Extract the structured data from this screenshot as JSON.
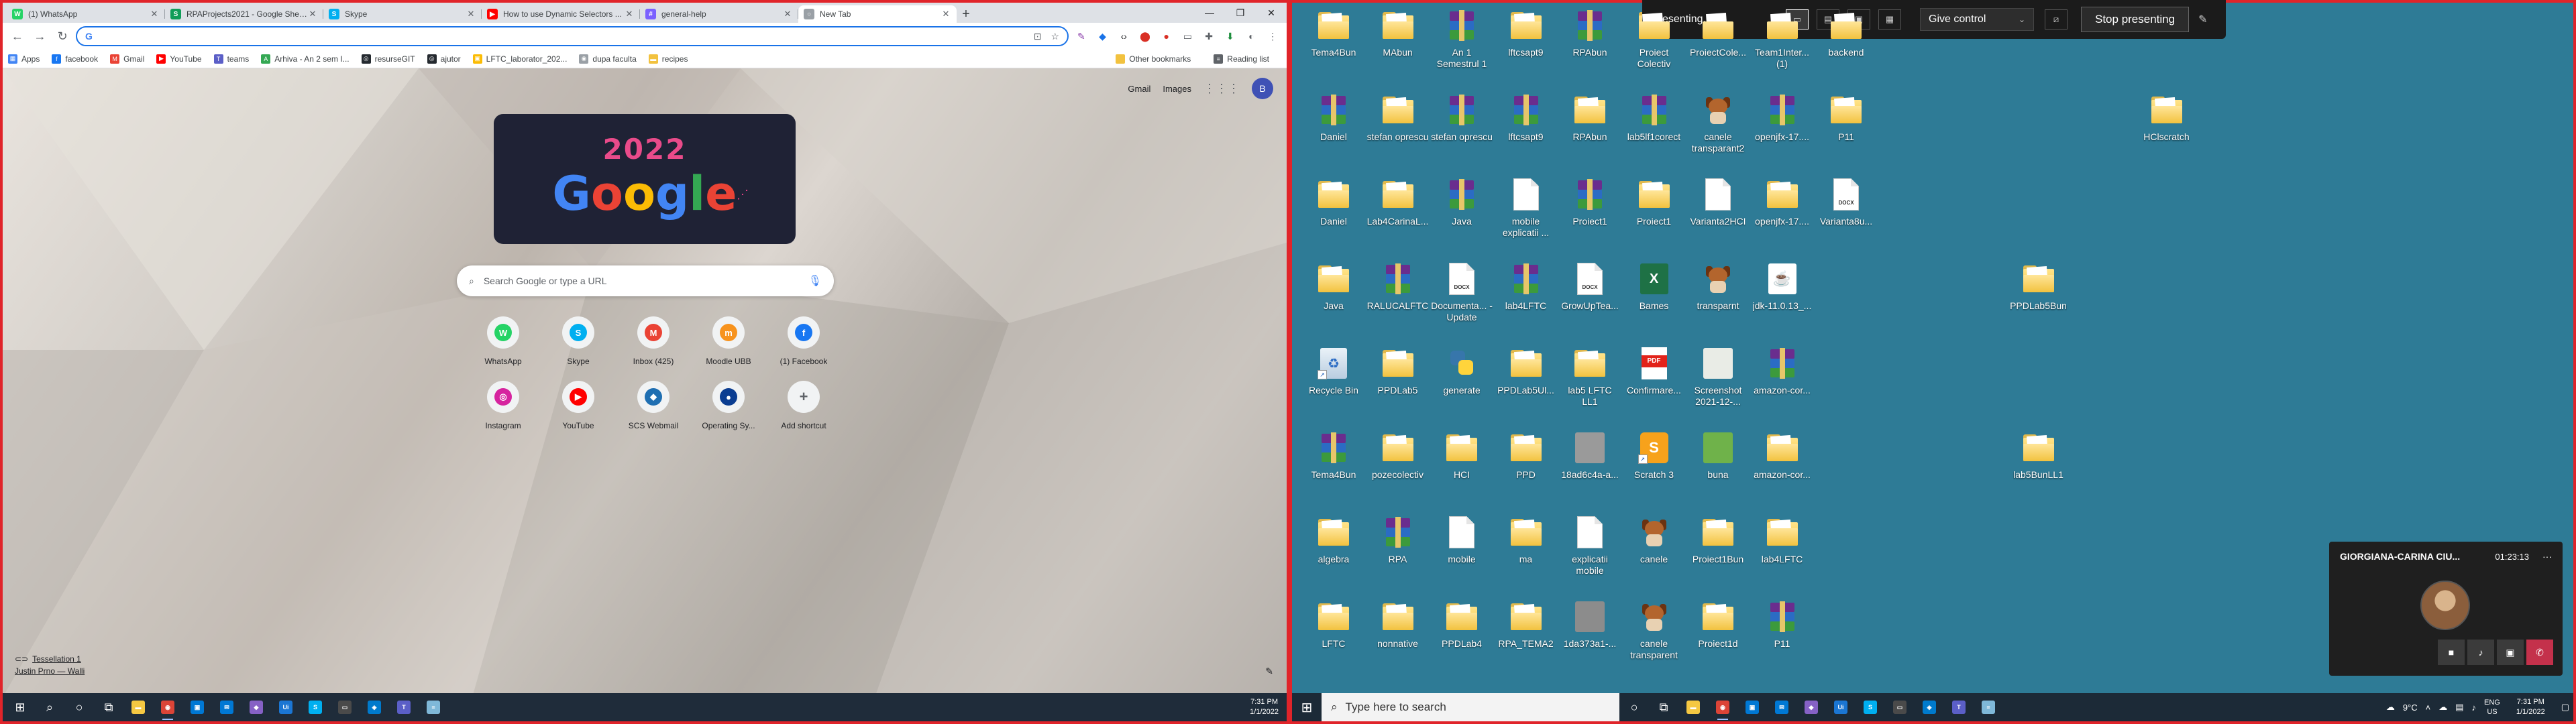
{
  "chrome": {
    "tabs": [
      {
        "label": "(1) WhatsApp",
        "color": "#25d366",
        "glyph": "W"
      },
      {
        "label": "RPAProjects2021 - Google Sheets",
        "color": "#0f9d58",
        "glyph": "S"
      },
      {
        "label": "Skype",
        "color": "#00aff0",
        "glyph": "S"
      },
      {
        "label": "How to use Dynamic Selectors ...",
        "color": "#ff0000",
        "glyph": "▶"
      },
      {
        "label": "general-help",
        "color": "#7b61ff",
        "glyph": "#"
      },
      {
        "label": "New Tab",
        "color": "#9aa0a6",
        "glyph": "○"
      }
    ],
    "window_controls": {
      "minimize": "—",
      "maximize": "❐",
      "close": "✕"
    },
    "nav": {
      "back": "←",
      "forward": "→",
      "reload": "↻"
    },
    "omnibox": {
      "prefix": "G",
      "value": ""
    },
    "bookmarks": [
      {
        "label": "Apps",
        "color": "#4285f4",
        "glyph": "▦"
      },
      {
        "label": "facebook",
        "color": "#1877f2",
        "glyph": "f"
      },
      {
        "label": "Gmail",
        "color": "#ea4335",
        "glyph": "M"
      },
      {
        "label": "YouTube",
        "color": "#ff0000",
        "glyph": "▶"
      },
      {
        "label": "teams",
        "color": "#5b5fc7",
        "glyph": "T"
      },
      {
        "label": "Arhiva - An 2 sem I...",
        "color": "#34a853",
        "glyph": "A"
      },
      {
        "label": "resurseGIT",
        "color": "#24292f",
        "glyph": "◎"
      },
      {
        "label": "ajutor",
        "color": "#24292f",
        "glyph": "◎"
      },
      {
        "label": "LFTC_laborator_202...",
        "color": "#fbbc05",
        "glyph": "▣"
      },
      {
        "label": "dupa faculta",
        "color": "#9aa0a6",
        "glyph": "◉"
      },
      {
        "label": "recipes",
        "color": "#f2c23f",
        "glyph": "▬"
      }
    ],
    "bookmarks_right": {
      "other": "Other bookmarks",
      "reading": "Reading list"
    },
    "ntp": {
      "top_links": {
        "gmail": "Gmail",
        "images": "Images",
        "avatar": "B"
      },
      "doodle": {
        "year": "2022",
        "word": [
          "G",
          "o",
          "o",
          "g",
          "l",
          "e"
        ]
      },
      "search_placeholder": "Search Google or type a URL",
      "shortcuts": [
        {
          "label": "WhatsApp",
          "color": "#25d366",
          "glyph": "W"
        },
        {
          "label": "Skype",
          "color": "#00aff0",
          "glyph": "S"
        },
        {
          "label": "Inbox (425)",
          "color": "#ea4335",
          "glyph": "M"
        },
        {
          "label": "Moodle UBB",
          "color": "#f7931e",
          "glyph": "m"
        },
        {
          "label": "(1) Facebook",
          "color": "#1877f2",
          "glyph": "f"
        },
        {
          "label": "Instagram",
          "color": "#d6249f",
          "glyph": "◎"
        },
        {
          "label": "YouTube",
          "color": "#ff0000",
          "glyph": "▶"
        },
        {
          "label": "SCS Webmail",
          "color": "#1f6fb2",
          "glyph": "◆"
        },
        {
          "label": "Operating Sy...",
          "color": "#0b3d91",
          "glyph": "●"
        },
        {
          "label": "Add shortcut",
          "color": "#5f6368",
          "glyph": "+"
        }
      ],
      "attribution": {
        "title": "Tessellation 1",
        "author": "Justin Prno — Walli"
      },
      "customize_icon": "✎"
    }
  },
  "left_taskbar": {
    "icons": [
      {
        "name": "windows-start-icon",
        "glyph": "⊞",
        "color": "#ffffff"
      },
      {
        "name": "search-icon",
        "glyph": "⌕",
        "color": "#ffffff"
      },
      {
        "name": "cortana-icon",
        "glyph": "○",
        "color": "#ffffff"
      },
      {
        "name": "task-view-icon",
        "glyph": "⧉",
        "color": "#ffffff"
      },
      {
        "name": "file-explorer-icon",
        "glyph": "▬",
        "color": "#f5c842"
      },
      {
        "name": "chrome-icon",
        "glyph": "◉",
        "color": "#db4437"
      },
      {
        "name": "store-icon",
        "glyph": "▣",
        "color": "#0078d4"
      },
      {
        "name": "mail-icon",
        "glyph": "✉",
        "color": "#0078d4"
      },
      {
        "name": "visual-studio-icon",
        "glyph": "◆",
        "color": "#8661c5"
      },
      {
        "name": "uipath-icon",
        "glyph": "Ui",
        "color": "#1b76d3"
      },
      {
        "name": "skype-icon",
        "glyph": "S",
        "color": "#00aff0"
      },
      {
        "name": "terminal-icon",
        "glyph": "▭",
        "color": "#4a4a4a"
      },
      {
        "name": "vscode-icon",
        "glyph": "◈",
        "color": "#007acc"
      },
      {
        "name": "teams-icon",
        "glyph": "T",
        "color": "#5b5fc7"
      },
      {
        "name": "notepad-icon",
        "glyph": "≡",
        "color": "#7fb8d8"
      }
    ],
    "time": "7:31 PM",
    "date": "1/1/2022"
  },
  "presenting": {
    "title": "Presenting...",
    "modes": [
      "▭",
      "▤",
      "▣",
      "▦"
    ],
    "give_control": "Give control",
    "chevron": "⌄",
    "screen_toggle": "⧄",
    "stop": "Stop presenting",
    "pin": "✎"
  },
  "call": {
    "name": "GIORGIANA-CARINA CIU...",
    "time": "01:23:13",
    "more": "···",
    "controls": {
      "video": "■",
      "mic": "♪",
      "share": "▣",
      "end": "✆"
    }
  },
  "desktop_icons": [
    {
      "label": "Tema4Bun",
      "type": "folder",
      "col": 0,
      "row": 0
    },
    {
      "label": "MAbun",
      "type": "folder",
      "col": 1,
      "row": 0
    },
    {
      "label": "An 1 Semestrul 1",
      "type": "rar",
      "col": 2,
      "row": 0
    },
    {
      "label": "lftcsapt9",
      "type": "folder",
      "col": 3,
      "row": 0
    },
    {
      "label": "RPAbun",
      "type": "rar",
      "col": 4,
      "row": 0
    },
    {
      "label": "Proiect Colectiv",
      "type": "folder",
      "col": 5,
      "row": 0
    },
    {
      "label": "ProiectCole...",
      "type": "folder",
      "col": 6,
      "row": 0
    },
    {
      "label": "Team1Inter... (1)",
      "type": "folder",
      "col": 7,
      "row": 0
    },
    {
      "label": "backend",
      "type": "folder",
      "col": 8,
      "row": 0
    },
    {
      "label": "Daniel",
      "type": "rar",
      "col": 0,
      "row": 1
    },
    {
      "label": "stefan oprescu",
      "type": "folder",
      "col": 1,
      "row": 1
    },
    {
      "label": "stefan oprescu",
      "type": "rar",
      "col": 2,
      "row": 1
    },
    {
      "label": "lftcsapt9",
      "type": "rar",
      "col": 3,
      "row": 1
    },
    {
      "label": "RPAbun",
      "type": "folder",
      "col": 4,
      "row": 1
    },
    {
      "label": "lab5lf1corect",
      "type": "rar",
      "col": 5,
      "row": 1
    },
    {
      "label": "canele transparant2",
      "type": "dog",
      "col": 6,
      "row": 1
    },
    {
      "label": "openjfx-17....",
      "type": "rar",
      "col": 7,
      "row": 1
    },
    {
      "label": "P11",
      "type": "folder",
      "col": 8,
      "row": 1
    },
    {
      "label": "HClscratch",
      "type": "folder",
      "col": 13,
      "row": 1
    },
    {
      "label": "Daniel",
      "type": "folder",
      "col": 0,
      "row": 2
    },
    {
      "label": "Lab4CarinaL...",
      "type": "folder",
      "col": 1,
      "row": 2
    },
    {
      "label": "Java",
      "type": "rar",
      "col": 2,
      "row": 2
    },
    {
      "label": "mobile explicatii ...",
      "type": "doc",
      "col": 3,
      "row": 2
    },
    {
      "label": "Proiect1",
      "type": "rar",
      "col": 4,
      "row": 2
    },
    {
      "label": "Proiect1",
      "type": "folder",
      "col": 5,
      "row": 2
    },
    {
      "label": "Varianta2HCI",
      "type": "doc",
      "col": 6,
      "row": 2
    },
    {
      "label": "openjfx-17....",
      "type": "folder",
      "col": 7,
      "row": 2
    },
    {
      "label": "Varianta8u...",
      "type": "doc",
      "col": 8,
      "row": 2,
      "tag": "DOCX"
    },
    {
      "label": "Java",
      "type": "folder",
      "col": 0,
      "row": 3
    },
    {
      "label": "RALUCALFTC",
      "type": "rar",
      "col": 1,
      "row": 3
    },
    {
      "label": "Documenta... - Update",
      "type": "doc",
      "col": 2,
      "row": 3,
      "tag": "DOCX"
    },
    {
      "label": "lab4LFTC",
      "type": "rar",
      "col": 3,
      "row": 3
    },
    {
      "label": "GrowUpTea...",
      "type": "doc",
      "col": 4,
      "row": 3,
      "tag": "DOCX"
    },
    {
      "label": "Bames",
      "type": "excel",
      "col": 5,
      "row": 3
    },
    {
      "label": "transparnt",
      "type": "dog",
      "col": 6,
      "row": 3
    },
    {
      "label": "jdk-11.0.13_...",
      "type": "java",
      "col": 7,
      "row": 3
    },
    {
      "label": "PPDLab5Bun",
      "type": "folder",
      "col": 11,
      "row": 3
    },
    {
      "label": "Recycle Bin",
      "type": "recycle",
      "col": 0,
      "row": 4
    },
    {
      "label": "PPDLab5",
      "type": "folder",
      "col": 1,
      "row": 4
    },
    {
      "label": "generate",
      "type": "python",
      "col": 2,
      "row": 4
    },
    {
      "label": "PPDLab5Ul...",
      "type": "folder",
      "col": 3,
      "row": 4
    },
    {
      "label": "lab5 LFTC LL1",
      "type": "folder",
      "col": 4,
      "row": 4
    },
    {
      "label": "Confirmare...",
      "type": "pdf",
      "col": 5,
      "row": 4
    },
    {
      "label": "Screenshot 2021-12-...",
      "type": "photo",
      "col": 6,
      "row": 4,
      "tint": "#e9ece6"
    },
    {
      "label": "amazon-cor...",
      "type": "rar",
      "col": 7,
      "row": 4
    },
    {
      "label": "Tema4Bun",
      "type": "rar",
      "col": 0,
      "row": 5
    },
    {
      "label": "pozecolectiv",
      "type": "folder",
      "col": 1,
      "row": 5
    },
    {
      "label": "HCI",
      "type": "folder",
      "col": 2,
      "row": 5
    },
    {
      "label": "PPD",
      "type": "folder",
      "col": 3,
      "row": 5
    },
    {
      "label": "18ad6c4a-a...",
      "type": "photo",
      "col": 4,
      "row": 5,
      "tint": "#9a9a9a"
    },
    {
      "label": "Scratch 3",
      "type": "scratch",
      "col": 5,
      "row": 5
    },
    {
      "label": "buna",
      "type": "photo",
      "col": 6,
      "row": 5,
      "tint": "#6fb24a"
    },
    {
      "label": "amazon-cor...",
      "type": "folder",
      "col": 7,
      "row": 5
    },
    {
      "label": "lab5BunLL1",
      "type": "folder",
      "col": 11,
      "row": 5
    },
    {
      "label": "algebra",
      "type": "folder",
      "col": 0,
      "row": 6
    },
    {
      "label": "RPA",
      "type": "rar",
      "col": 1,
      "row": 6
    },
    {
      "label": "mobile",
      "type": "doc",
      "col": 2,
      "row": 6
    },
    {
      "label": "ma",
      "type": "folder",
      "col": 3,
      "row": 6
    },
    {
      "label": "explicatii mobile",
      "type": "doc",
      "col": 4,
      "row": 6
    },
    {
      "label": "canele",
      "type": "dog",
      "col": 5,
      "row": 6
    },
    {
      "label": "Proiect1Bun",
      "type": "folder",
      "col": 6,
      "row": 6
    },
    {
      "label": "lab4LFTC",
      "type": "folder",
      "col": 7,
      "row": 6
    },
    {
      "label": "LFTC",
      "type": "folder",
      "col": 0,
      "row": 7
    },
    {
      "label": "nonnative",
      "type": "folder",
      "col": 1,
      "row": 7
    },
    {
      "label": "PPDLab4",
      "type": "folder",
      "col": 2,
      "row": 7
    },
    {
      "label": "RPA_TEMA2",
      "type": "folder",
      "col": 3,
      "row": 7
    },
    {
      "label": "1da373a1-...",
      "type": "photo",
      "col": 4,
      "row": 7,
      "tint": "#8c8c8c"
    },
    {
      "label": "canele transparent",
      "type": "dog",
      "col": 5,
      "row": 7
    },
    {
      "label": "Proiect1d",
      "type": "folder",
      "col": 6,
      "row": 7
    },
    {
      "label": "P11",
      "type": "rar",
      "col": 7,
      "row": 7
    }
  ],
  "right_taskbar": {
    "start": "⊞",
    "search_placeholder": "Type here to search",
    "search_icon": "⌕",
    "icons": [
      {
        "name": "cortana-icon",
        "glyph": "○",
        "color": "#ffffff"
      },
      {
        "name": "task-view-icon",
        "glyph": "⧉",
        "color": "#ffffff"
      },
      {
        "name": "file-explorer-icon",
        "glyph": "▬",
        "color": "#f5c842"
      },
      {
        "name": "chrome-icon",
        "glyph": "◉",
        "color": "#db4437"
      },
      {
        "name": "store-icon",
        "glyph": "▣",
        "color": "#0078d4"
      },
      {
        "name": "mail-icon",
        "glyph": "✉",
        "color": "#0078d4"
      },
      {
        "name": "visual-studio-icon",
        "glyph": "◆",
        "color": "#8661c5"
      },
      {
        "name": "uipath-icon",
        "glyph": "Ui",
        "color": "#1b76d3"
      },
      {
        "name": "skype-icon",
        "glyph": "S",
        "color": "#00aff0"
      },
      {
        "name": "terminal-icon",
        "glyph": "▭",
        "color": "#4a4a4a"
      },
      {
        "name": "vscode-icon",
        "glyph": "◈",
        "color": "#007acc"
      },
      {
        "name": "teams-icon",
        "glyph": "T",
        "color": "#5b5fc7"
      },
      {
        "name": "notepad-icon",
        "glyph": "≡",
        "color": "#7fb8d8"
      }
    ],
    "weather": "9°C",
    "lang_top": "ENG",
    "lang_bottom": "US",
    "time": "7:31 PM",
    "date": "1/1/2022"
  }
}
